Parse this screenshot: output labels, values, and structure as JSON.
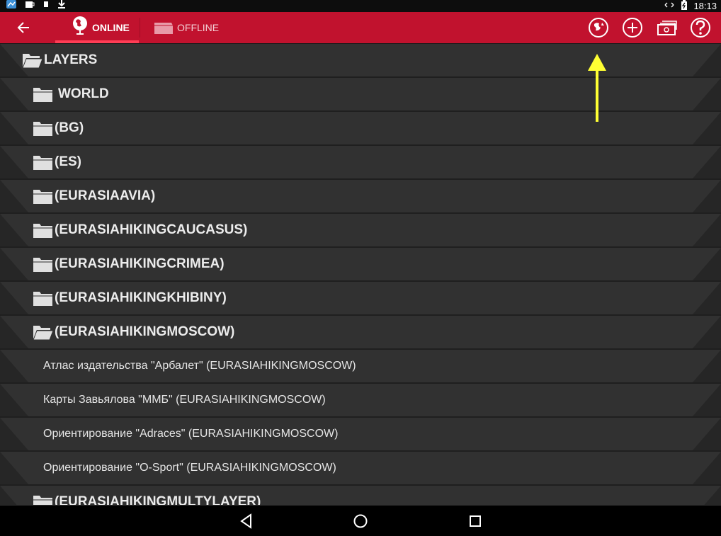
{
  "status_bar": {
    "time": "18:13",
    "left_icons": [
      "map-app-icon",
      "coffee-icon",
      "phone-icon",
      "download-icon"
    ],
    "right_icons": [
      "sync-icon",
      "battery-icon"
    ]
  },
  "action_bar": {
    "tabs": [
      {
        "label": "ONLINE",
        "selected": true,
        "icon": "globe-icon"
      },
      {
        "label": "OFFLINE",
        "selected": false,
        "icon": "folder-icon"
      }
    ],
    "actions": [
      "refresh-globe-icon",
      "add-icon",
      "money-icon",
      "help-icon"
    ],
    "color": "#c1122e"
  },
  "list": {
    "root": "LAYERS",
    "folders": [
      {
        "label": "WORLD"
      },
      {
        "label": "(BG)"
      },
      {
        "label": "(ES)"
      },
      {
        "label": "(EURASIAAVIA)"
      },
      {
        "label": "(EURASIAHIKINGCAUCASUS)"
      },
      {
        "label": "(EURASIAHIKINGCRIMEA)"
      },
      {
        "label": "(EURASIAHIKINGKHIBINY)"
      },
      {
        "label": "(EURASIAHIKINGMOSCOW)",
        "expanded": true
      }
    ],
    "children": [
      "Атлас издательства \"Арбалет\" (EURASIAHIKINGMOSCOW)",
      "Карты Завьялова \"ММБ\" (EURASIAHIKINGMOSCOW)",
      "Ориентирование \"Adraces\" (EURASIAHIKINGMOSCOW)",
      "Ориентирование \"O-Sport\" (EURASIAHIKINGMOSCOW)"
    ],
    "last_folder": "(EURASIAHIKINGMULTYLAYER)"
  },
  "nav_bar": {
    "buttons": [
      "back-triangle-icon",
      "home-circle-icon",
      "recents-square-icon"
    ]
  },
  "annotation_color": "#ffff33"
}
